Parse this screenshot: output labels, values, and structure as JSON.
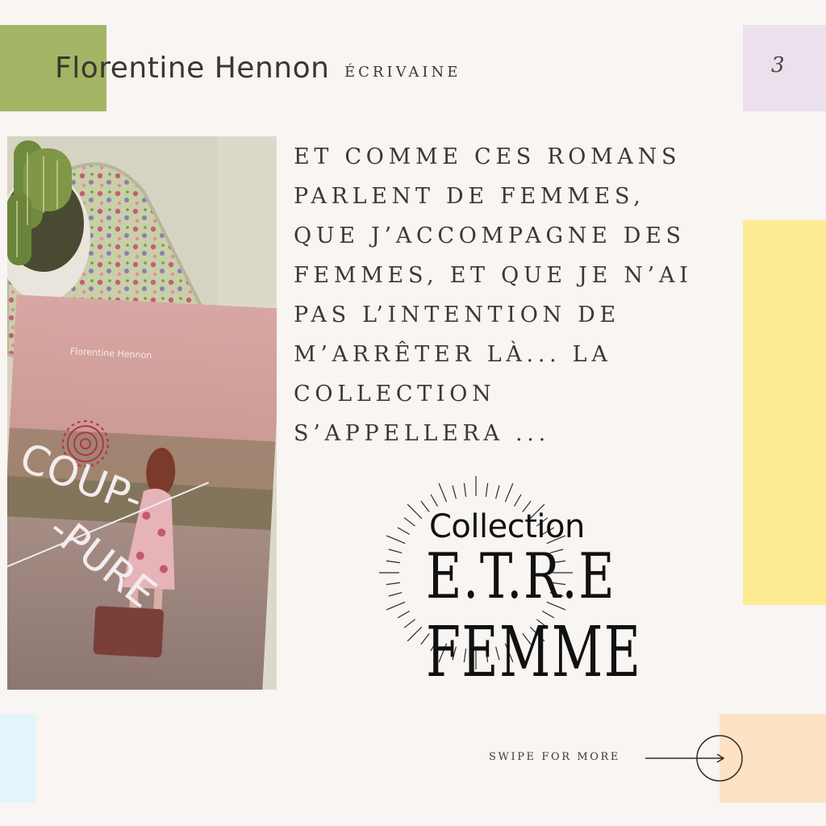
{
  "header": {
    "author_name": "Florentine Hennon",
    "author_role": "ÉCRIVAINE",
    "page_number": "3"
  },
  "photo": {
    "book_author": "Florentine Hennon",
    "book_title_line1": "COUP-",
    "book_title_line2": "-PURE"
  },
  "main": {
    "text_lines": [
      "ET COMME CES ROMANS",
      "PARLENT DE FEMMES,",
      "QUE J’ACCOMPAGNE DES",
      "FEMMES, ET QUE JE N’AI",
      "PAS L’INTENTION DE",
      "M’ARRÊTER LÀ... LA",
      "COLLECTION",
      "S’APPELLERA ..."
    ]
  },
  "logo": {
    "line1": "Collection",
    "line2": "E.T.R.E",
    "line3": "FEMME"
  },
  "footer": {
    "swipe_label": "SWIPE FOR MORE"
  },
  "colors": {
    "background": "#f8f5f2",
    "green": "#a4b565",
    "lilac": "#ebe0ec",
    "yellow": "#fdec94",
    "cyan": "#e1f5fb",
    "peach": "#fde2c3",
    "text": "#3d3835"
  },
  "icons": [
    "arrow-right-circle-icon"
  ]
}
